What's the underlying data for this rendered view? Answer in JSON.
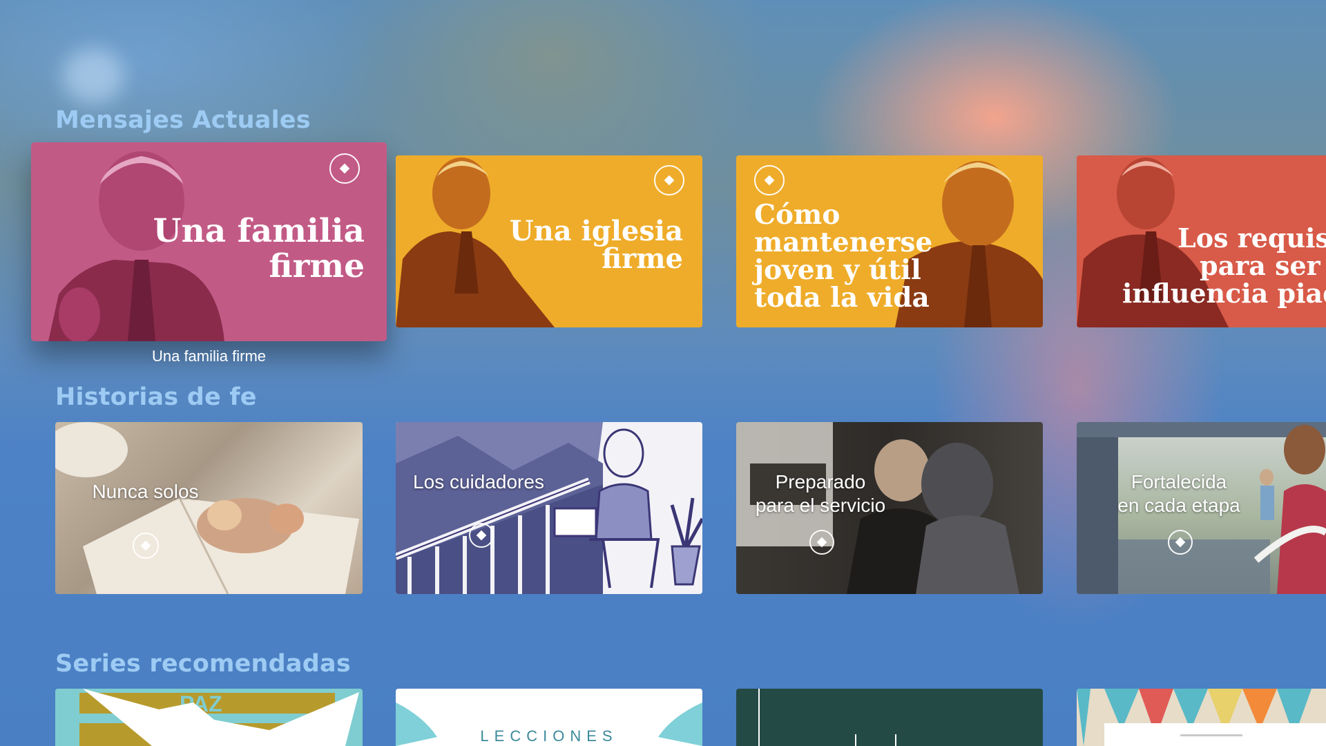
{
  "sections": [
    {
      "title": "Mensajes Actuales",
      "items": [
        {
          "title": "Una familia firme",
          "color": "#c25a86",
          "focused": true,
          "focus_label": "Una familia firme"
        },
        {
          "title": "Una iglesia firme",
          "color": "#efac2a"
        },
        {
          "title": "Cómo mantenerse joven y útil toda la vida",
          "color": "#efac2a"
        },
        {
          "title": "Los requisi para ser u influencia piado",
          "color": "#d85a48"
        }
      ]
    },
    {
      "title": "Historias de fe",
      "items": [
        {
          "title": "Nunca solos"
        },
        {
          "title": "Los cuidadores"
        },
        {
          "title": "Preparado para el servicio"
        },
        {
          "title": "Fortalecida en cada etapa"
        }
      ]
    },
    {
      "title": "Series recomendadas",
      "items": [
        {
          "title": "PAZ"
        },
        {
          "title": "LECCIONES"
        },
        {
          "title": ""
        },
        {
          "title": ""
        }
      ]
    }
  ],
  "hero_lines": {
    "familia": [
      "Una familia",
      "firme"
    ],
    "iglesia": [
      "Una iglesia",
      "firme"
    ],
    "joven": [
      "Cómo",
      "mantenerse",
      "joven y útil",
      "toda la vida"
    ],
    "requisitos": [
      "Los requisi",
      "para ser u",
      "influencia piado"
    ]
  },
  "story_lines": {
    "nunca": [
      "Nunca solos"
    ],
    "cuidadores": [
      "Los cuidadores"
    ],
    "preparado": [
      "Preparado",
      "para el servicio"
    ],
    "fortalecida": [
      "Fortalecida",
      "en cada etapa"
    ]
  },
  "icons": {
    "badge": "dove-logo-icon"
  }
}
